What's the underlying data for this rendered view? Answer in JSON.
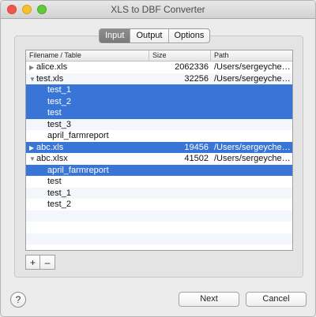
{
  "window": {
    "title": "XLS to DBF Converter"
  },
  "tabs": [
    {
      "label": "Input",
      "active": true
    },
    {
      "label": "Output",
      "active": false
    },
    {
      "label": "Options",
      "active": false
    }
  ],
  "table": {
    "headers": {
      "name": "Filename / Table",
      "size": "Size",
      "path": "Path"
    },
    "rows": [
      {
        "type": "file",
        "expanded": false,
        "name": "alice.xls",
        "size": "2062336",
        "path": "/Users/sergeyche…",
        "selected": false
      },
      {
        "type": "file",
        "expanded": true,
        "name": "test.xls",
        "size": "32256",
        "path": "/Users/sergeyche…",
        "selected": false
      },
      {
        "type": "table",
        "name": "test_1",
        "size": "",
        "path": "",
        "selected": true
      },
      {
        "type": "table",
        "name": "test_2",
        "size": "",
        "path": "",
        "selected": true
      },
      {
        "type": "table",
        "name": "test",
        "size": "",
        "path": "",
        "selected": true
      },
      {
        "type": "table",
        "name": "test_3",
        "size": "",
        "path": "",
        "selected": false
      },
      {
        "type": "table",
        "name": "april_farmreport",
        "size": "",
        "path": "",
        "selected": false
      },
      {
        "type": "file",
        "expanded": false,
        "name": "abc.xls",
        "size": "19456",
        "path": "/Users/sergeyche…",
        "selected": true
      },
      {
        "type": "file",
        "expanded": true,
        "name": "abc.xlsx",
        "size": "41502",
        "path": "/Users/sergeyche…",
        "selected": false
      },
      {
        "type": "table",
        "name": "april_farmreport",
        "size": "",
        "path": "",
        "selected": true
      },
      {
        "type": "table",
        "name": "test",
        "size": "",
        "path": "",
        "selected": false
      },
      {
        "type": "table",
        "name": "test_1",
        "size": "",
        "path": "",
        "selected": false
      },
      {
        "type": "table",
        "name": "test_2",
        "size": "",
        "path": "",
        "selected": false
      }
    ],
    "total_visible_rows": 16
  },
  "list_buttons": {
    "add": "+",
    "remove": "–"
  },
  "help": {
    "label": "?"
  },
  "footer": {
    "next": "Next",
    "cancel": "Cancel"
  },
  "colors": {
    "selection": "#3875d7",
    "alt_row": "#f3f6fb"
  },
  "icons": {
    "collapsed": "disclosure-triangle-right-icon",
    "expanded": "disclosure-triangle-down-icon"
  }
}
